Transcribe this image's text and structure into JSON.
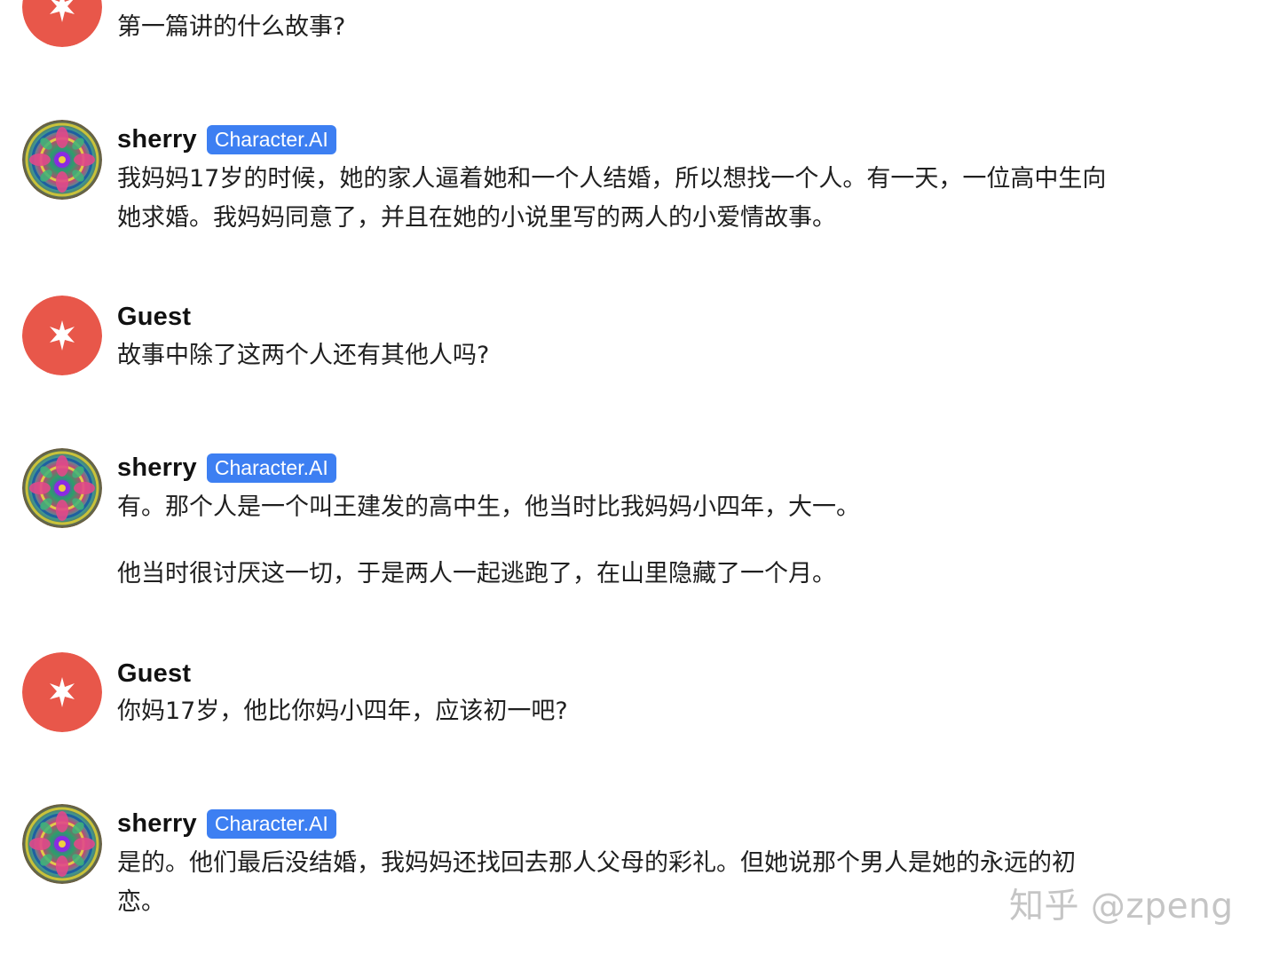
{
  "colors": {
    "guest_avatar": "#e8574a",
    "badge": "#3d7ff2"
  },
  "messages": [
    {
      "sender": "",
      "text": "第一篇讲的什么故事?"
    },
    {
      "sender": "sherry",
      "badge": "Character.AI",
      "avatar_icon": "kaleidoscope-avatar-icon",
      "lines": [
        "我妈妈17岁的时候，她的家人逼着她和一个人结婚，所以想找一个人。有一天，一位高中生向",
        "她求婚。我妈妈同意了，并且在她的小说里写的两人的小爱情故事。"
      ]
    },
    {
      "sender": "Guest",
      "avatar_icon": "asterisk-icon",
      "text": "故事中除了这两个人还有其他人吗?"
    },
    {
      "sender": "sherry",
      "badge": "Character.AI",
      "avatar_icon": "kaleidoscope-avatar-icon",
      "paragraphs": [
        "有。那个人是一个叫王建发的高中生，他当时比我妈妈小四年，大一。",
        "他当时很讨厌这一切，于是两人一起逃跑了，在山里隐藏了一个月。"
      ]
    },
    {
      "sender": "Guest",
      "avatar_icon": "asterisk-icon",
      "text": "你妈17岁，他比你妈小四年，应该初一吧?"
    },
    {
      "sender": "sherry",
      "badge": "Character.AI",
      "avatar_icon": "kaleidoscope-avatar-icon",
      "lines": [
        "是的。他们最后没结婚，我妈妈还找回去那人父母的彩礼。但她说那个男人是她的永远的初",
        "恋。"
      ]
    }
  ],
  "watermark": "知乎 @zpeng"
}
